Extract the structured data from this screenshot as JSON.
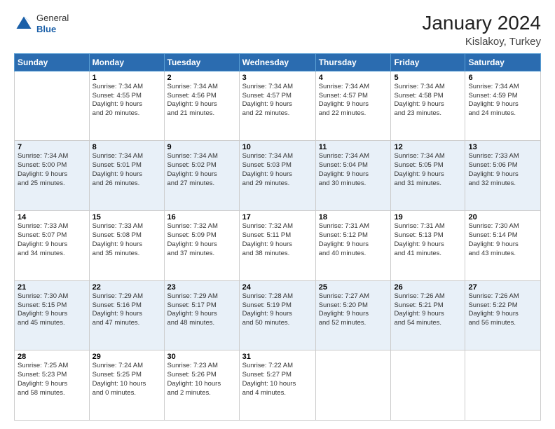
{
  "header": {
    "logo_general": "General",
    "logo_blue": "Blue",
    "title": "January 2024",
    "subtitle": "Kislakoy, Turkey"
  },
  "days_of_week": [
    "Sunday",
    "Monday",
    "Tuesday",
    "Wednesday",
    "Thursday",
    "Friday",
    "Saturday"
  ],
  "weeks": [
    [
      {
        "num": "",
        "info": ""
      },
      {
        "num": "1",
        "info": "Sunrise: 7:34 AM\nSunset: 4:55 PM\nDaylight: 9 hours\nand 20 minutes."
      },
      {
        "num": "2",
        "info": "Sunrise: 7:34 AM\nSunset: 4:56 PM\nDaylight: 9 hours\nand 21 minutes."
      },
      {
        "num": "3",
        "info": "Sunrise: 7:34 AM\nSunset: 4:57 PM\nDaylight: 9 hours\nand 22 minutes."
      },
      {
        "num": "4",
        "info": "Sunrise: 7:34 AM\nSunset: 4:57 PM\nDaylight: 9 hours\nand 22 minutes."
      },
      {
        "num": "5",
        "info": "Sunrise: 7:34 AM\nSunset: 4:58 PM\nDaylight: 9 hours\nand 23 minutes."
      },
      {
        "num": "6",
        "info": "Sunrise: 7:34 AM\nSunset: 4:59 PM\nDaylight: 9 hours\nand 24 minutes."
      }
    ],
    [
      {
        "num": "7",
        "info": "Sunrise: 7:34 AM\nSunset: 5:00 PM\nDaylight: 9 hours\nand 25 minutes."
      },
      {
        "num": "8",
        "info": "Sunrise: 7:34 AM\nSunset: 5:01 PM\nDaylight: 9 hours\nand 26 minutes."
      },
      {
        "num": "9",
        "info": "Sunrise: 7:34 AM\nSunset: 5:02 PM\nDaylight: 9 hours\nand 27 minutes."
      },
      {
        "num": "10",
        "info": "Sunrise: 7:34 AM\nSunset: 5:03 PM\nDaylight: 9 hours\nand 29 minutes."
      },
      {
        "num": "11",
        "info": "Sunrise: 7:34 AM\nSunset: 5:04 PM\nDaylight: 9 hours\nand 30 minutes."
      },
      {
        "num": "12",
        "info": "Sunrise: 7:34 AM\nSunset: 5:05 PM\nDaylight: 9 hours\nand 31 minutes."
      },
      {
        "num": "13",
        "info": "Sunrise: 7:33 AM\nSunset: 5:06 PM\nDaylight: 9 hours\nand 32 minutes."
      }
    ],
    [
      {
        "num": "14",
        "info": "Sunrise: 7:33 AM\nSunset: 5:07 PM\nDaylight: 9 hours\nand 34 minutes."
      },
      {
        "num": "15",
        "info": "Sunrise: 7:33 AM\nSunset: 5:08 PM\nDaylight: 9 hours\nand 35 minutes."
      },
      {
        "num": "16",
        "info": "Sunrise: 7:32 AM\nSunset: 5:09 PM\nDaylight: 9 hours\nand 37 minutes."
      },
      {
        "num": "17",
        "info": "Sunrise: 7:32 AM\nSunset: 5:11 PM\nDaylight: 9 hours\nand 38 minutes."
      },
      {
        "num": "18",
        "info": "Sunrise: 7:31 AM\nSunset: 5:12 PM\nDaylight: 9 hours\nand 40 minutes."
      },
      {
        "num": "19",
        "info": "Sunrise: 7:31 AM\nSunset: 5:13 PM\nDaylight: 9 hours\nand 41 minutes."
      },
      {
        "num": "20",
        "info": "Sunrise: 7:30 AM\nSunset: 5:14 PM\nDaylight: 9 hours\nand 43 minutes."
      }
    ],
    [
      {
        "num": "21",
        "info": "Sunrise: 7:30 AM\nSunset: 5:15 PM\nDaylight: 9 hours\nand 45 minutes."
      },
      {
        "num": "22",
        "info": "Sunrise: 7:29 AM\nSunset: 5:16 PM\nDaylight: 9 hours\nand 47 minutes."
      },
      {
        "num": "23",
        "info": "Sunrise: 7:29 AM\nSunset: 5:17 PM\nDaylight: 9 hours\nand 48 minutes."
      },
      {
        "num": "24",
        "info": "Sunrise: 7:28 AM\nSunset: 5:19 PM\nDaylight: 9 hours\nand 50 minutes."
      },
      {
        "num": "25",
        "info": "Sunrise: 7:27 AM\nSunset: 5:20 PM\nDaylight: 9 hours\nand 52 minutes."
      },
      {
        "num": "26",
        "info": "Sunrise: 7:26 AM\nSunset: 5:21 PM\nDaylight: 9 hours\nand 54 minutes."
      },
      {
        "num": "27",
        "info": "Sunrise: 7:26 AM\nSunset: 5:22 PM\nDaylight: 9 hours\nand 56 minutes."
      }
    ],
    [
      {
        "num": "28",
        "info": "Sunrise: 7:25 AM\nSunset: 5:23 PM\nDaylight: 9 hours\nand 58 minutes."
      },
      {
        "num": "29",
        "info": "Sunrise: 7:24 AM\nSunset: 5:25 PM\nDaylight: 10 hours\nand 0 minutes."
      },
      {
        "num": "30",
        "info": "Sunrise: 7:23 AM\nSunset: 5:26 PM\nDaylight: 10 hours\nand 2 minutes."
      },
      {
        "num": "31",
        "info": "Sunrise: 7:22 AM\nSunset: 5:27 PM\nDaylight: 10 hours\nand 4 minutes."
      },
      {
        "num": "",
        "info": ""
      },
      {
        "num": "",
        "info": ""
      },
      {
        "num": "",
        "info": ""
      }
    ]
  ]
}
